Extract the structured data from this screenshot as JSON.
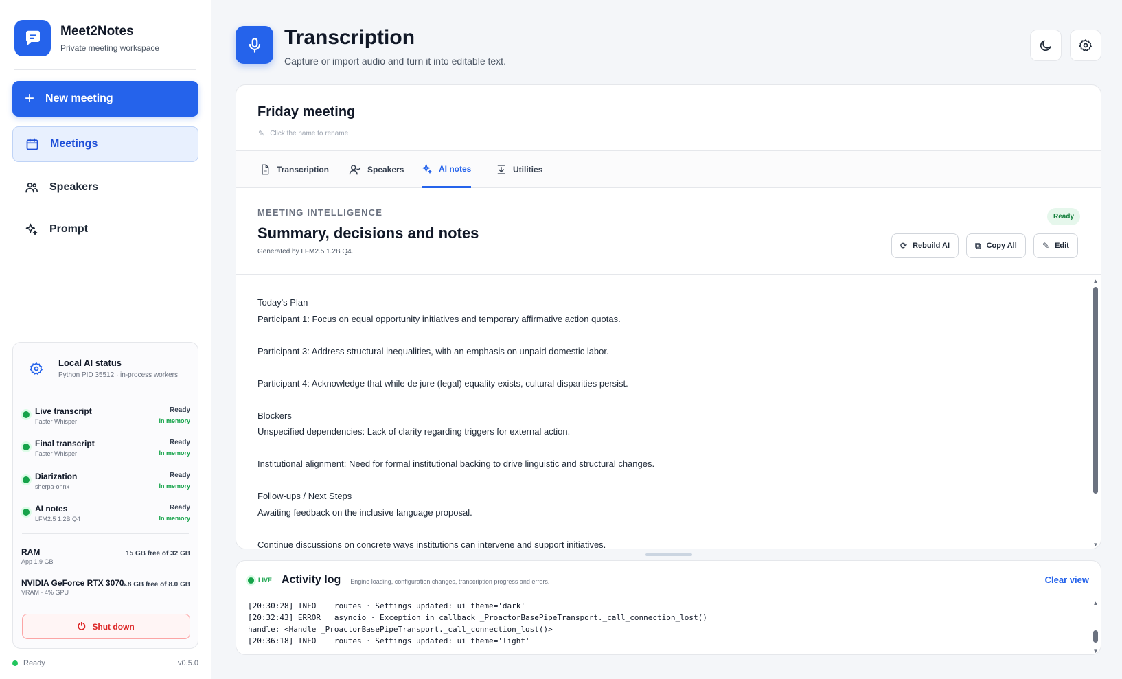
{
  "app": {
    "name": "Meet2Notes",
    "subtitle": "Private meeting workspace",
    "version": "v0.5.0",
    "status": "Ready"
  },
  "sidebar": {
    "new_meeting": "New meeting",
    "nav": [
      {
        "label": "Meetings",
        "icon": "calendar-icon",
        "active": true
      },
      {
        "label": "Speakers",
        "icon": "users-icon"
      },
      {
        "label": "Prompt",
        "icon": "sparkle-icon"
      }
    ],
    "ai_status": {
      "title": "Local AI status",
      "subtitle": "Python PID 35512 · in-process workers",
      "services": [
        {
          "name": "Live transcript",
          "engine": "Faster Whisper",
          "status": "Ready",
          "memory": "In memory"
        },
        {
          "name": "Final transcript",
          "engine": "Faster Whisper",
          "status": "Ready",
          "memory": "In memory"
        },
        {
          "name": "Diarization",
          "engine": "sherpa-onnx",
          "status": "Ready",
          "memory": "In memory"
        },
        {
          "name": "AI notes",
          "engine": "LFM2.5 1.2B Q4",
          "status": "Ready",
          "memory": "In memory"
        }
      ],
      "resources": [
        {
          "name": "RAM",
          "sub": "App 1.9 GB",
          "value": "15 GB free of 32 GB"
        },
        {
          "name": "NVIDIA GeForce RTX 3070",
          "sub": "VRAM · 4% GPU",
          "value": "5.8 GB free of 8.0 GB"
        }
      ],
      "shutdown": "Shut down"
    }
  },
  "header": {
    "title": "Transcription",
    "subtitle": "Capture or import audio and turn it into editable text."
  },
  "meeting": {
    "title": "Friday meeting",
    "rename_hint": "Click the name to rename",
    "tabs": [
      {
        "label": "Transcription",
        "icon": "document-icon"
      },
      {
        "label": "Speakers",
        "icon": "user-check-icon"
      },
      {
        "label": "AI notes",
        "icon": "sparkle-icon",
        "active": true
      },
      {
        "label": "Utilities",
        "icon": "download-icon"
      }
    ],
    "ai_notes": {
      "kicker": "MEETING INTELLIGENCE",
      "title": "Summary, decisions and notes",
      "generated_by": "Generated by LFM2.5 1.2B Q4.",
      "badge": "Ready",
      "buttons": {
        "rebuild": "Rebuild AI",
        "copy_all": "Copy All",
        "edit": "Edit"
      },
      "lines": [
        "Today's Plan",
        "Participant 1: Focus on equal opportunity initiatives and temporary affirmative action quotas.",
        "",
        "Participant 3: Address structural inequalities, with an emphasis on unpaid domestic labor.",
        "",
        "Participant 4: Acknowledge that while de jure (legal) equality exists, cultural disparities persist.",
        "",
        "Blockers",
        "Unspecified dependencies: Lack of clarity regarding triggers for external action.",
        "",
        "Institutional alignment: Need for formal institutional backing to drive linguistic and structural changes.",
        "",
        "Follow-ups / Next Steps",
        "Awaiting feedback on the inclusive language proposal.",
        "",
        "Continue discussions on concrete ways institutions can intervene and support initiatives."
      ]
    }
  },
  "activity_log": {
    "live": "LIVE",
    "title": "Activity log",
    "subtitle": "Engine loading, configuration changes, transcription progress and errors.",
    "clear": "Clear view",
    "lines": [
      "[20:30:28] INFO    routes · Settings updated: ui_theme='dark'",
      "[20:32:43] ERROR   asyncio · Exception in callback _ProactorBasePipeTransport._call_connection_lost()",
      "handle: <Handle _ProactorBasePipeTransport._call_connection_lost()>",
      "[20:36:18] INFO    routes · Settings updated: ui_theme='light'"
    ]
  },
  "colors": {
    "accent": "#2563eb",
    "success": "#16a34a",
    "danger": "#dc2626"
  }
}
